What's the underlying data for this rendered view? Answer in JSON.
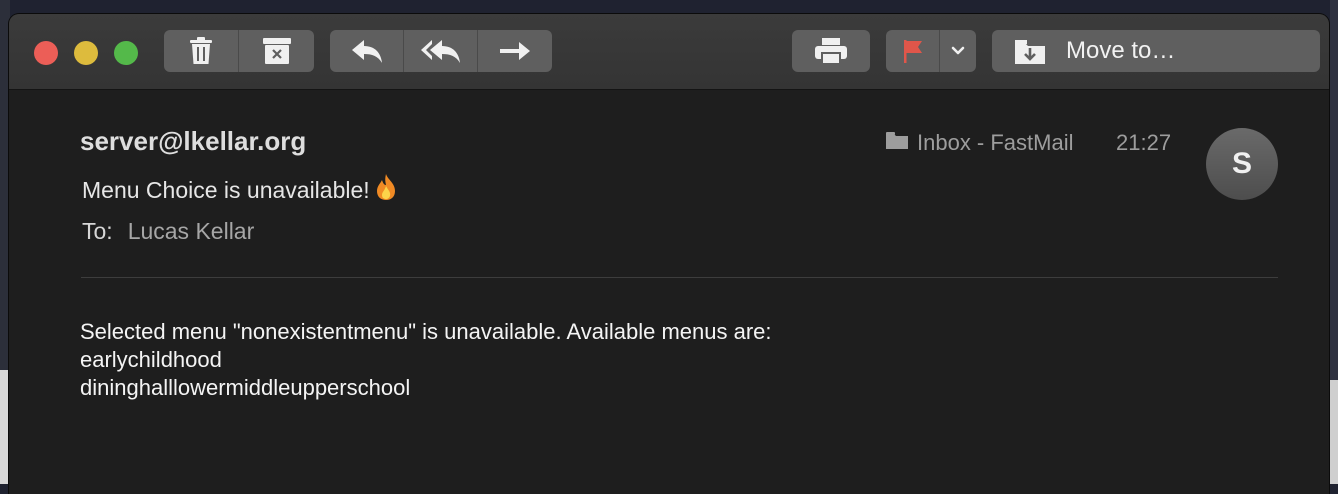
{
  "toolbar": {
    "buttons": [
      "trash-icon",
      "archive-icon",
      "reply-icon",
      "reply-all-icon",
      "forward-icon",
      "print-icon",
      "flag-icon",
      "chevron-down-icon"
    ],
    "move_to_label": "Move to…",
    "flag_color": "#e0564a"
  },
  "message": {
    "sender": "server@lkellar.org",
    "subject": "Menu Choice is unavailable!",
    "subject_emoji": "fire-emoji-icon",
    "to_label": "To:",
    "to_value": "Lucas Kellar",
    "mailbox": "Inbox - FastMail",
    "time": "21:27",
    "avatar_initial": "S",
    "body_lines": [
      "Selected menu \"nonexistentmenu\" is unavailable. Available menus are:",
      "earlychildhood",
      "dininghalllowermiddleupperschool"
    ]
  }
}
